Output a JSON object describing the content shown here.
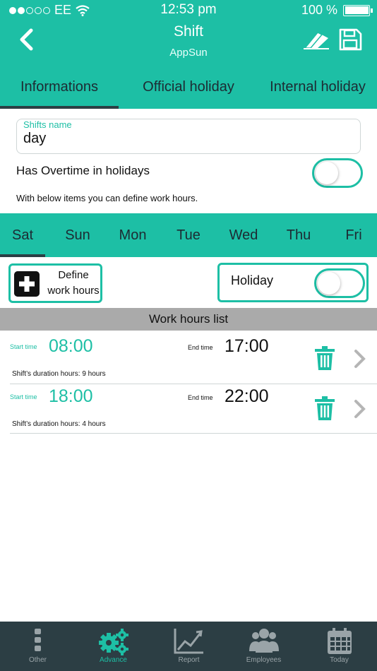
{
  "status_bar": {
    "carrier": "EE",
    "time": "12:53 pm",
    "battery": "100 %"
  },
  "header": {
    "title": "Shift",
    "subtitle": "AppSun"
  },
  "tabs": [
    {
      "label": "Informations",
      "active": true
    },
    {
      "label": "Official holiday",
      "active": false
    },
    {
      "label": "Internal holiday",
      "active": false
    }
  ],
  "form": {
    "shift_name_label": "Shifts name",
    "shift_name_value": "day",
    "overtime_label": "Has Overtime in holidays",
    "overtime_on": false,
    "hint": "With below items you can define work hours."
  },
  "days": [
    {
      "label": "Sat",
      "active": true
    },
    {
      "label": "Sun",
      "active": false
    },
    {
      "label": "Mon",
      "active": false
    },
    {
      "label": "Tue",
      "active": false
    },
    {
      "label": "Wed",
      "active": false
    },
    {
      "label": "Thu",
      "active": false
    },
    {
      "label": "Fri",
      "active": false
    }
  ],
  "define_button": {
    "line1": "Define",
    "line2": "work hours"
  },
  "holiday": {
    "label": "Holiday",
    "on": false
  },
  "work_hours": {
    "header": "Work hours list",
    "items": [
      {
        "start_label": "Start time",
        "start": "08:00",
        "end_label": "End time",
        "end": "17:00",
        "duration": "Shift’s duration hours: 9 hours"
      },
      {
        "start_label": "Start time",
        "start": "18:00",
        "end_label": "End time",
        "end": "22:00",
        "duration": "Shift’s duration hours: 4 hours"
      }
    ]
  },
  "bottom_nav": [
    {
      "label": "Other",
      "icon": "more-icon",
      "active": false
    },
    {
      "label": "Advance",
      "icon": "gears-icon",
      "active": true
    },
    {
      "label": "Report",
      "icon": "chart-icon",
      "active": false
    },
    {
      "label": "Employees",
      "icon": "people-icon",
      "active": false
    },
    {
      "label": "Today",
      "icon": "calendar-icon",
      "active": false
    }
  ],
  "colors": {
    "accent": "#1dbfa5",
    "dark": "#2c3e44",
    "list_header": "#aaaaaa"
  }
}
